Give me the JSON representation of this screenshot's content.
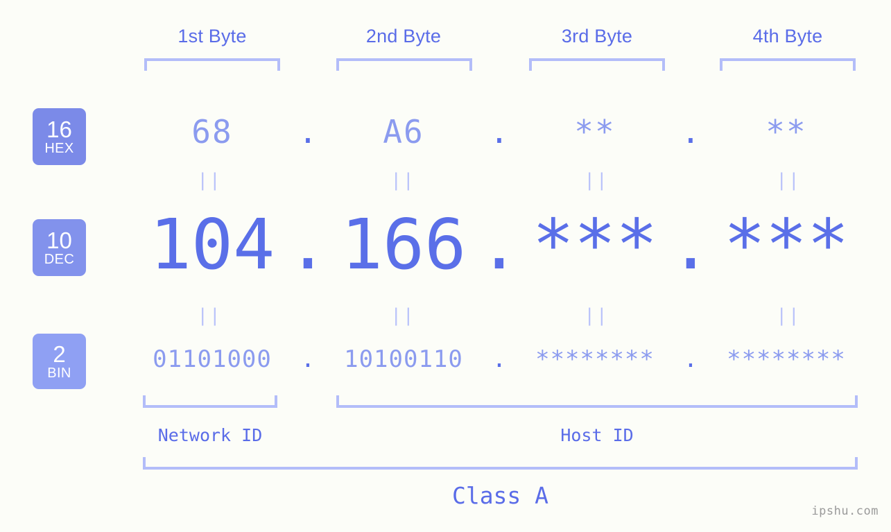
{
  "page": {
    "background_color": "#fcfdf8",
    "accent_color": "#5a6ce8",
    "accent_light_color": "#8b9bef",
    "bracket_color": "#b3bdf9",
    "watermark": "ipshu.com"
  },
  "byte_headers": [
    {
      "label": "1st Byte"
    },
    {
      "label": "2nd Byte"
    },
    {
      "label": "3rd Byte"
    },
    {
      "label": "4th Byte"
    }
  ],
  "rows": [
    {
      "id": "hex",
      "badge_number": "16",
      "badge_name": "HEX",
      "badge_color": "#7b8ae8",
      "values": [
        "68",
        "A6",
        "**",
        "**"
      ],
      "separator": "."
    },
    {
      "id": "dec",
      "badge_number": "10",
      "badge_name": "DEC",
      "badge_color": "#8292ec",
      "values": [
        "104",
        "166",
        "***",
        "***"
      ],
      "separator": "."
    },
    {
      "id": "bin",
      "badge_number": "2",
      "badge_name": "BIN",
      "badge_color": "#8fa0f3",
      "values": [
        "01101000",
        "10100110",
        "********",
        "********"
      ],
      "separator": "."
    }
  ],
  "connectors": {
    "symbol": "||",
    "count_per_row": 4
  },
  "sections": {
    "network_id": "Network ID",
    "host_id": "Host ID",
    "class": "Class A"
  }
}
